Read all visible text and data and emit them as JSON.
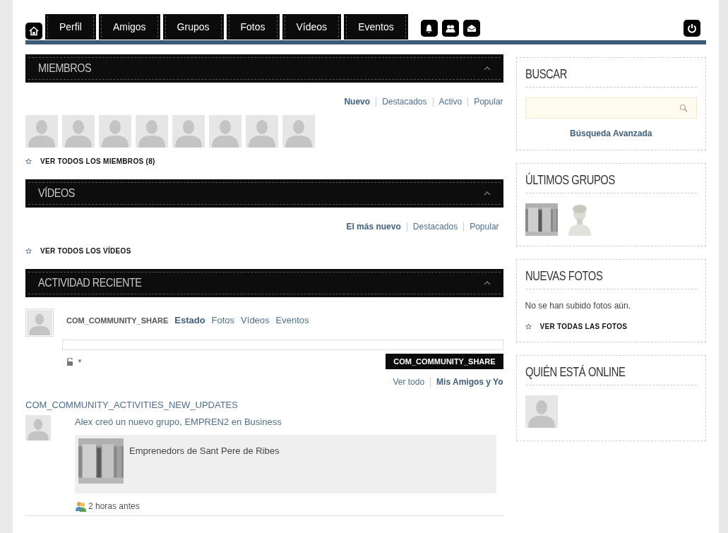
{
  "nav": {
    "items": [
      {
        "label": "Perfil"
      },
      {
        "label": "Amigos"
      },
      {
        "label": "Grupos"
      },
      {
        "label": "Fotos"
      },
      {
        "label": "Vídeos"
      },
      {
        "label": "Eventos"
      }
    ]
  },
  "members": {
    "title": "MIEMBROS",
    "filters": [
      {
        "label": "Nuevo",
        "selected": true
      },
      {
        "label": "Destacados",
        "selected": false
      },
      {
        "label": "Activo",
        "selected": false
      },
      {
        "label": "Popular",
        "selected": false
      }
    ],
    "link": "VER TODOS LOS MIEMBROS (8)"
  },
  "videos": {
    "title": "VÍDEOS",
    "filters": [
      {
        "label": "El más nuevo",
        "selected": true
      },
      {
        "label": "Destacados",
        "selected": false
      },
      {
        "label": "Popular",
        "selected": false
      }
    ],
    "link": "VER TODOS LOS VÍDEOS"
  },
  "activity": {
    "title": "ACTIVIDAD RECIENTE",
    "composer": {
      "label": "COM_COMMUNITY_SHARE",
      "tabs": [
        {
          "label": "Estado",
          "selected": true
        },
        {
          "label": "Fotos",
          "selected": false
        },
        {
          "label": "Vídeos",
          "selected": false
        },
        {
          "label": "Eventos",
          "selected": false
        }
      ],
      "privacy_caret": "▼",
      "button": "COM_COMMUNITY_SHARE"
    },
    "filters": [
      {
        "label": "Ver todo",
        "selected": false
      },
      {
        "label": "Mis Amigos y Yo",
        "selected": true
      }
    ],
    "updates_title": "COM_COMMUNITY_ACTIVITIES_NEW_UPDATES",
    "items": [
      {
        "text": "Alex creó un nuevo grupo, EMPREN2 en Business",
        "card_title": "Emprenedors de Sant Pere de Ribes",
        "time": "2 horas antes"
      }
    ]
  },
  "sidebar": {
    "search": {
      "title": "BUSCAR",
      "link": "Búsqueda Avanzada"
    },
    "groups": {
      "title": "ÚLTIMOS GRUPOS",
      "items": [
        {
          "kind": "columns"
        },
        {
          "kind": "bust"
        }
      ]
    },
    "photos": {
      "title": "NUEVAS FOTOS",
      "empty": "No se han subido fotos aún.",
      "link": "VER TODAS LAS FOTOS"
    },
    "online": {
      "title": "QUIÉN ESTÁ ONLINE"
    }
  }
}
